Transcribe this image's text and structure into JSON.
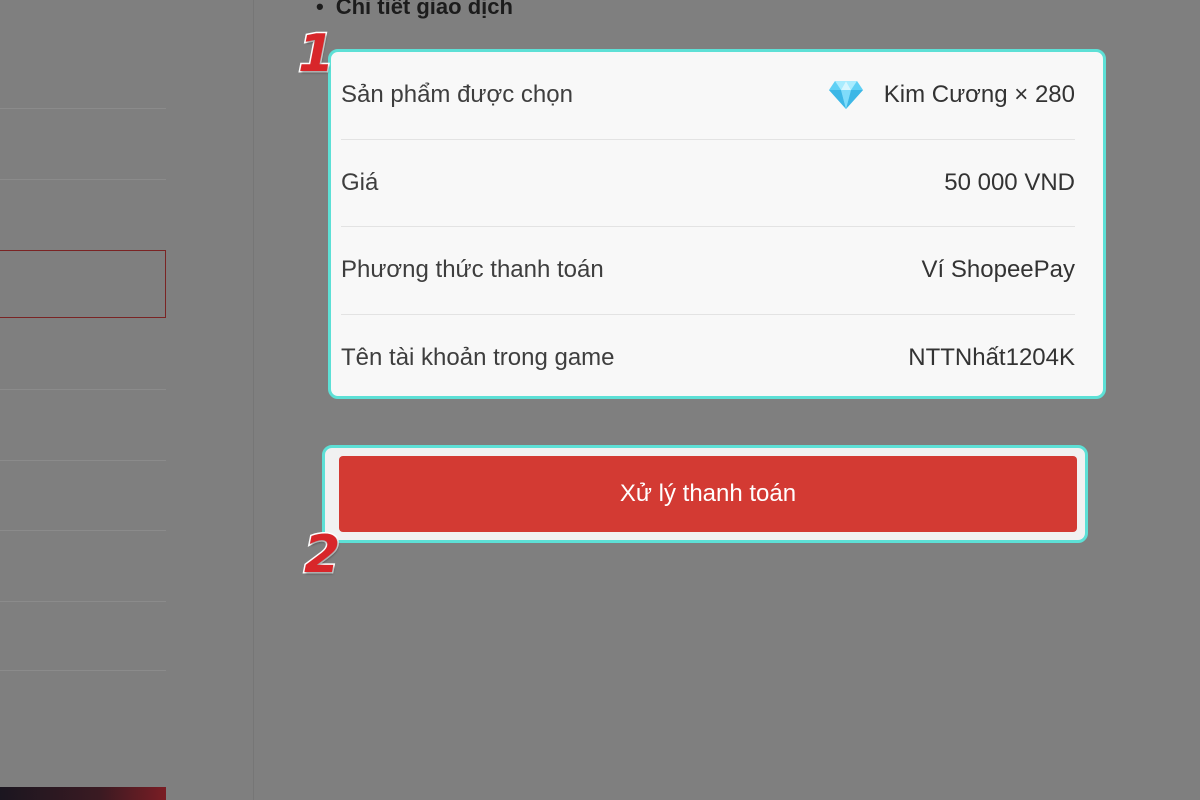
{
  "section": {
    "bullet": "•",
    "title": "Chi tiết giao dịch"
  },
  "details": [
    {
      "label": "Sản phẩm được chọn",
      "value": "Kim Cương × 280",
      "icon": "diamond-icon"
    },
    {
      "label": "Giá",
      "value": "50 000 VND"
    },
    {
      "label": "Phương thức thanh toán",
      "value": "Ví ShopeePay"
    },
    {
      "label": "Tên tài khoản trong game",
      "value": "NTTNhất1204K"
    }
  ],
  "action": {
    "process_label": "Xử lý thanh toán"
  },
  "annotations": {
    "step1": "1",
    "step2": "2"
  },
  "colors": {
    "highlight": "#5de0d6",
    "button": "#d33a33",
    "marker": "#d8262a",
    "overlay": "#7f7f7f"
  }
}
